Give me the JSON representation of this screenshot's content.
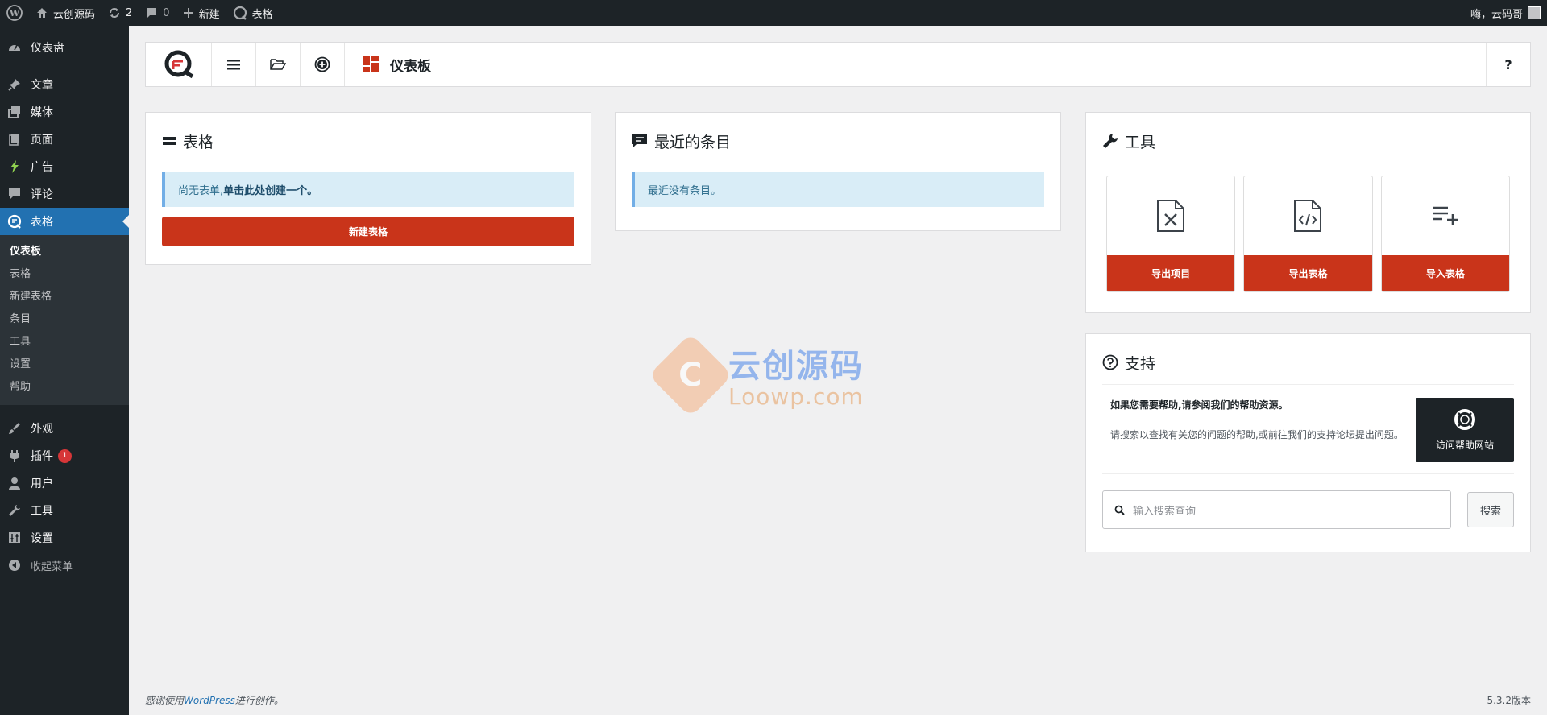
{
  "adminbar": {
    "site_name": "云创源码",
    "updates_count": "2",
    "comments_count": "0",
    "new_label": "新建",
    "plugin_label": "表格",
    "greeting": "嗨，云码哥"
  },
  "sidebar": {
    "items": [
      {
        "label": "仪表盘",
        "icon": "dashboard-icon"
      },
      {
        "label": "文章",
        "icon": "pin-icon"
      },
      {
        "label": "媒体",
        "icon": "media-icon"
      },
      {
        "label": "页面",
        "icon": "page-icon"
      },
      {
        "label": "广告",
        "icon": "bolt-icon"
      },
      {
        "label": "评论",
        "icon": "comment-icon"
      },
      {
        "label": "表格",
        "icon": "forms-icon"
      }
    ],
    "submenu": [
      "仪表板",
      "表格",
      "新建表格",
      "条目",
      "工具",
      "设置",
      "帮助"
    ],
    "bottom_items": [
      {
        "label": "外观",
        "icon": "brush-icon"
      },
      {
        "label": "插件",
        "icon": "plugin-icon",
        "badge": "1"
      },
      {
        "label": "用户",
        "icon": "user-icon"
      },
      {
        "label": "工具",
        "icon": "wrench-icon"
      },
      {
        "label": "设置",
        "icon": "settings-icon"
      }
    ],
    "collapse_label": "收起菜单"
  },
  "topbar": {
    "title": "仪表板",
    "help": "?"
  },
  "forms_panel": {
    "title": "表格",
    "notice_text": "尚无表单,",
    "notice_link": "单击此处创建一个。",
    "button": "新建表格"
  },
  "entries_panel": {
    "title": "最近的条目",
    "notice_text": "最近没有条目。"
  },
  "tools_panel": {
    "title": "工具",
    "cards": [
      {
        "label": "导出项目",
        "icon": "file-excel-icon"
      },
      {
        "label": "导出表格",
        "icon": "file-code-icon"
      },
      {
        "label": "导入表格",
        "icon": "playlist-add-icon"
      }
    ]
  },
  "support_panel": {
    "title": "支持",
    "intro": "如果您需要帮助,请参阅我们的帮助资源。",
    "desc": "请搜索以查找有关您的问题的帮助,或前往我们的支持论坛提出问题。",
    "help_site": "访问帮助网站",
    "search_placeholder": "输入搜索查询",
    "search_button": "搜索"
  },
  "watermark": {
    "cn": "云创源码",
    "en": "Loowp.com"
  },
  "footer": {
    "thanks_pre": "感谢使用",
    "thanks_link": "WordPress",
    "thanks_post": "进行创作。",
    "version": "5.3.2版本"
  }
}
